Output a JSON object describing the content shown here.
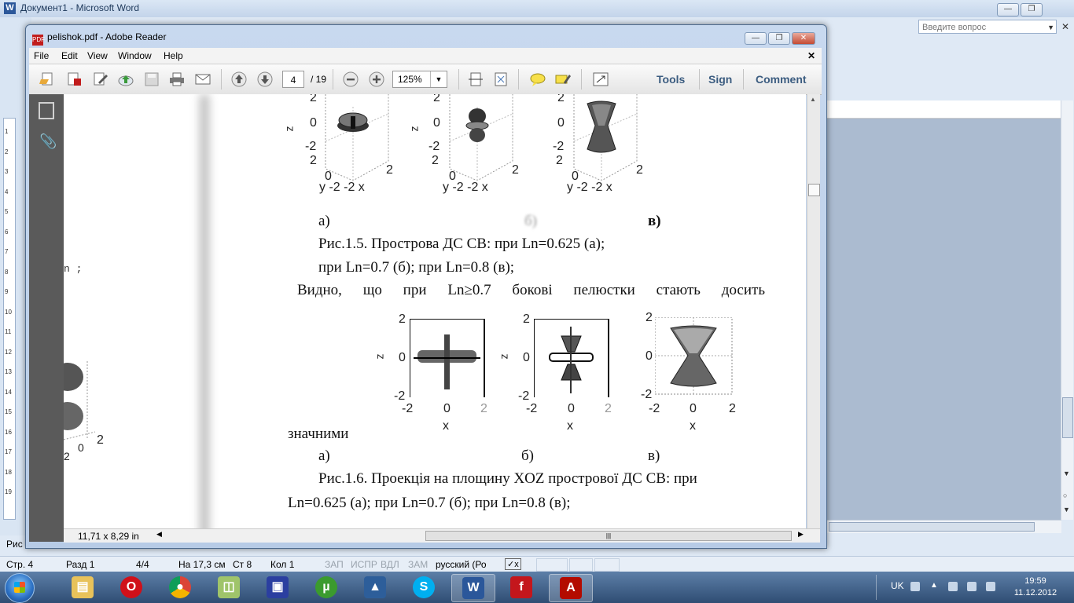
{
  "word": {
    "title": "Документ1 - Microsoft Word",
    "ask_placeholder": "Введите вопрос",
    "ruler_numbers": [
      "1",
      "2",
      "3",
      "4",
      "5",
      "6",
      "7",
      "8",
      "9",
      "10",
      "11",
      "12",
      "13",
      "14",
      "15",
      "16",
      "17",
      "18",
      "19"
    ],
    "left_fragment": "n ;",
    "below_label": "Рис",
    "status": {
      "page": "Стр. 4",
      "section": "Разд 1",
      "pages": "4/4",
      "position": "На 17,3 см",
      "line": "Ст 8",
      "column": "Кол 1",
      "rec": "ЗАП",
      "trk": "ИСПР",
      "ext": "ВДЛ",
      "ovr": "ЗАМ",
      "language": "русский (Ро"
    }
  },
  "reader": {
    "title": "pelishok.pdf - Adobe Reader",
    "menu": [
      "File",
      "Edit",
      "View",
      "Window",
      "Help"
    ],
    "page_current": "4",
    "page_total": "/ 19",
    "zoom": "125%",
    "links": {
      "tools": "Tools",
      "sign": "Sign",
      "comment": "Comment"
    },
    "page_size": "11,71 x 8,29 in"
  },
  "document": {
    "fig15_labels": [
      "а)",
      "б)",
      "в)"
    ],
    "fig15_caption_1": "Рис.1.5.  Прострова ДС СВ: при Ln=0.625 (а);",
    "fig15_caption_2": "при Ln=0.7 (б); при Ln=0.8 (в);",
    "paragraph": "Видно,  що  при  Ln≥0.7  бокові  пелюстки  стають  досить",
    "paragraph_end": "значними",
    "fig16_labels": [
      "а)",
      "б)",
      "в)"
    ],
    "fig16_caption_1": "Рис.1.6.  Проекція на площину XOZ прострової ДС СВ: при",
    "fig16_caption_2": "Ln=0.625 (а); при Ln=0.7 (б); при Ln=0.8 (в);",
    "axis_3d": {
      "z_top": "2",
      "z_mid": "0",
      "z_bot": "-2",
      "y_zero": "0",
      "x_right": "2",
      "bottom": "y -2 -2 x"
    },
    "axis_2d": {
      "top": "2",
      "mid": "0",
      "bot": "-2",
      "xl": "-2",
      "xm": "0",
      "xr": "2",
      "xlabel": "x",
      "zlabel": "z"
    }
  },
  "taskbar": {
    "apps": [
      "explorer",
      "opera",
      "chrome",
      "files",
      "save",
      "utorrent",
      "matlab",
      "skype",
      "word",
      "flash",
      "acrobat"
    ],
    "lang": "UK",
    "time": "19:59",
    "date": "11.12.2012"
  }
}
